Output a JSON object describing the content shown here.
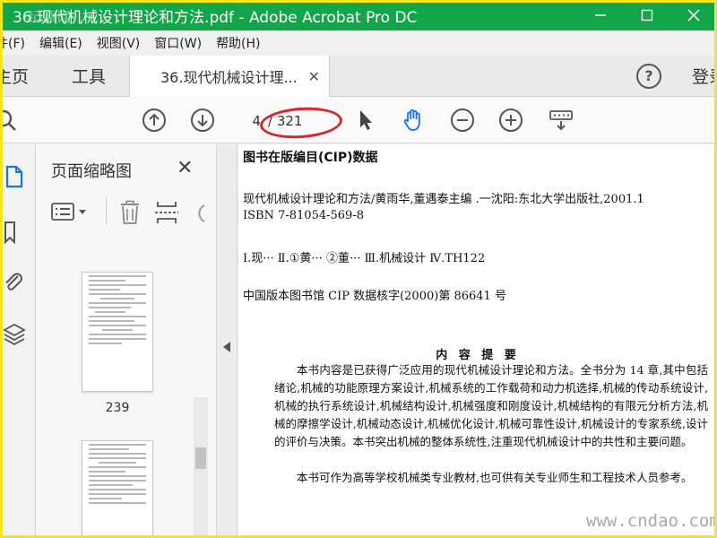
{
  "window": {
    "title": "36.现代机械设计理论和方法.pdf - Adobe Acrobat Pro DC",
    "logo_text": "起源网"
  },
  "menu": [
    "件(F)",
    "编辑(E)",
    "视图(V)",
    "窗口(W)",
    "帮助(H)"
  ],
  "tabs": {
    "home": "主页",
    "tools": "工具",
    "document": "36.现代机械设计理...",
    "close": "✕"
  },
  "header": {
    "help": "?",
    "login": "登录"
  },
  "toolbar": {
    "current_page": "4",
    "total_pages": "/ 321"
  },
  "panel": {
    "title": "页面缩略图",
    "close": "✕",
    "thumbnails": [
      {
        "label": "239"
      }
    ]
  },
  "document": {
    "cip_title": "图书在版编目(CIP)数据",
    "line1": "现代机械设计理论和方法/黄雨华,董遇泰主编 .一沈阳:东北大学出版社,2001.1",
    "line2": "ISBN 7-81054-569-8",
    "line3": "Ⅰ.现···  Ⅱ.①黄···  ②董···  Ⅲ.机械设计  Ⅳ.TH122",
    "line4": "中国版本图书馆 CIP 数据核字(2000)第 86641 号",
    "abstract_title": "内 容 提 要",
    "para1": "本书内容是已获得广泛应用的现代机械设计理论和方法。全书分为 14 章,其中包括绪论,机械的功能原理方案设计,机械系统的工作载荷和动力机选择,机械的传动系统设计,机械的执行系统设计,机械结构设计,机械强度和刚度设计,机械结构的有限元分析方法,机械的摩擦学设计,机械动态设计,机械优化设计,机械可靠性设计,机械设计的专家系统,设计的评价与决策。本书突出机械的整体系统性,注重现代机械设计中的共性和主要问题。",
    "para2": "本书可作为高等学校机械类专业教材,也可供有关专业师生和工程技术人员参考。"
  },
  "watermark": "www.cndao.com",
  "colors": {
    "titlebar": "#12a54a",
    "annotation": "#d9262b",
    "accent": "#1473e6",
    "frame": "#f5e61a"
  }
}
